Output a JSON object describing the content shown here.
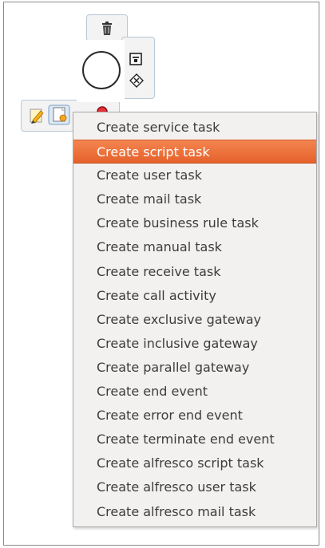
{
  "menu": {
    "items": [
      "Create service task",
      "Create script task",
      "Create user task",
      "Create mail task",
      "Create business rule task",
      "Create manual task",
      "Create receive task",
      "Create call activity",
      "Create exclusive gateway",
      "Create inclusive gateway",
      "Create parallel gateway",
      "Create end event",
      "Create error end event",
      "Create terminate end event",
      "Create alfresco script task",
      "Create alfresco user task",
      "Create alfresco mail task"
    ],
    "selected_index": 1
  },
  "context_pad": {
    "icons": [
      "delete-icon",
      "text-annotation-icon",
      "gateway-icon",
      "edit-icon",
      "task-icon",
      "end-event-icon"
    ]
  },
  "colors": {
    "selection": "#e96d36",
    "pad_border": "#b7c8d6",
    "menu_bg": "#f2f1f0"
  }
}
